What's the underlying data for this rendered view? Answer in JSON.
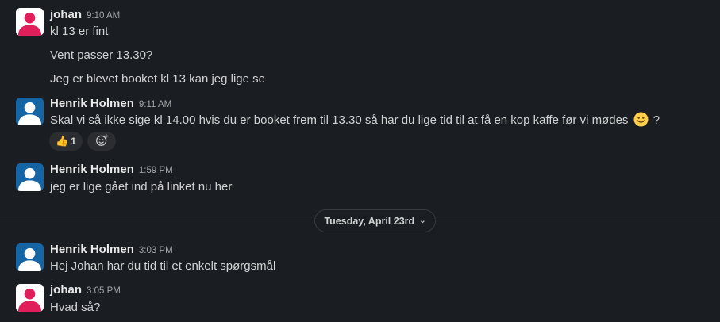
{
  "messages": [
    {
      "author": "johan",
      "time": "9:10 AM",
      "lines": [
        "kl 13 er fint",
        "Vent passer 13.30?",
        "Jeg er blevet booket kl 13 kan jeg lige se"
      ]
    },
    {
      "author": "Henrik Holmen",
      "time": "9:11 AM",
      "text_before_emoji": "Skal vi så ikke sige kl 14.00 hvis du er booket frem til 13.30 så har du lige tid til at få en kop kaffe før vi mødes",
      "text_after_emoji": "?",
      "emoji": "slightly-smiling-face",
      "reactions": [
        {
          "icon": "thumbs-up",
          "glyph": "👍",
          "count": "1"
        }
      ],
      "add_reaction_icon": "add-emoji-icon"
    },
    {
      "author": "Henrik Holmen",
      "time": "1:59 PM",
      "lines": [
        "jeg er lige gået ind på linket nu her"
      ]
    },
    {
      "author": "Henrik Holmen",
      "time": "3:03 PM",
      "lines": [
        "Hej Johan har du tid til et enkelt spørgsmål"
      ]
    },
    {
      "author": "johan",
      "time": "3:05 PM",
      "lines": [
        "Hvad så?"
      ]
    }
  ],
  "date_divider": {
    "label": "Tuesday, April 23rd",
    "chevron": "⌄"
  },
  "colors": {
    "background": "#1a1d21",
    "johan_avatar": "#e01e5a",
    "henrik_avatar": "#1565a5"
  }
}
